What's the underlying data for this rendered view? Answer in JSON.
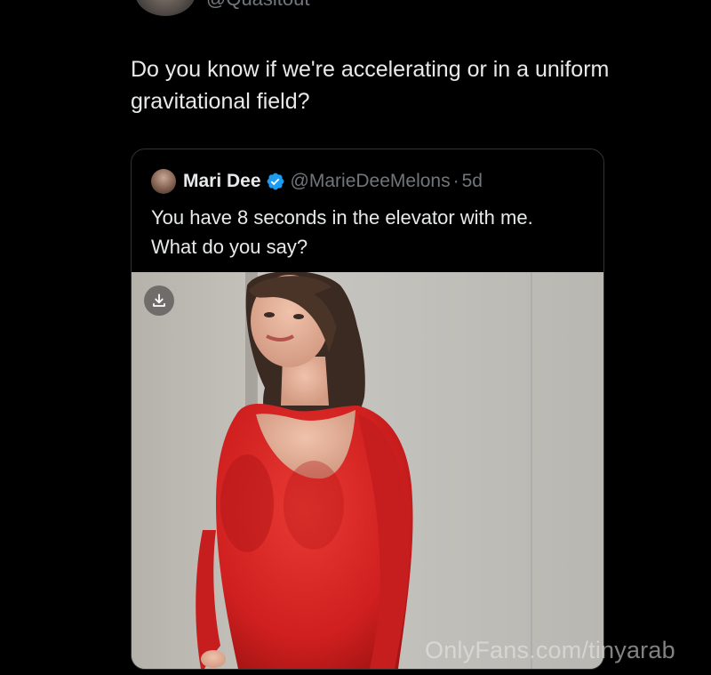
{
  "tweet": {
    "author_handle": "@Quasitout",
    "text": "Do you know if we're accelerating or in a uniform gravitational field?"
  },
  "quoted_tweet": {
    "author_name": "Mari Dee",
    "author_handle": "@MarieDeeMelons",
    "separator": "·",
    "time": "5d",
    "text": "You have 8 seconds in the elevator with me. What do you say?",
    "media": {
      "download_icon": "download-icon",
      "description": "photo"
    }
  },
  "icons": {
    "verified": "verified-badge-icon",
    "download": "download-icon"
  },
  "colors": {
    "background": "#000000",
    "text_primary": "#e7e9ea",
    "text_secondary": "#71767b",
    "verified_blue": "#1d9bf0",
    "dress_red": "#d62424"
  },
  "watermark": "OnlyFans.com/tinyarab"
}
